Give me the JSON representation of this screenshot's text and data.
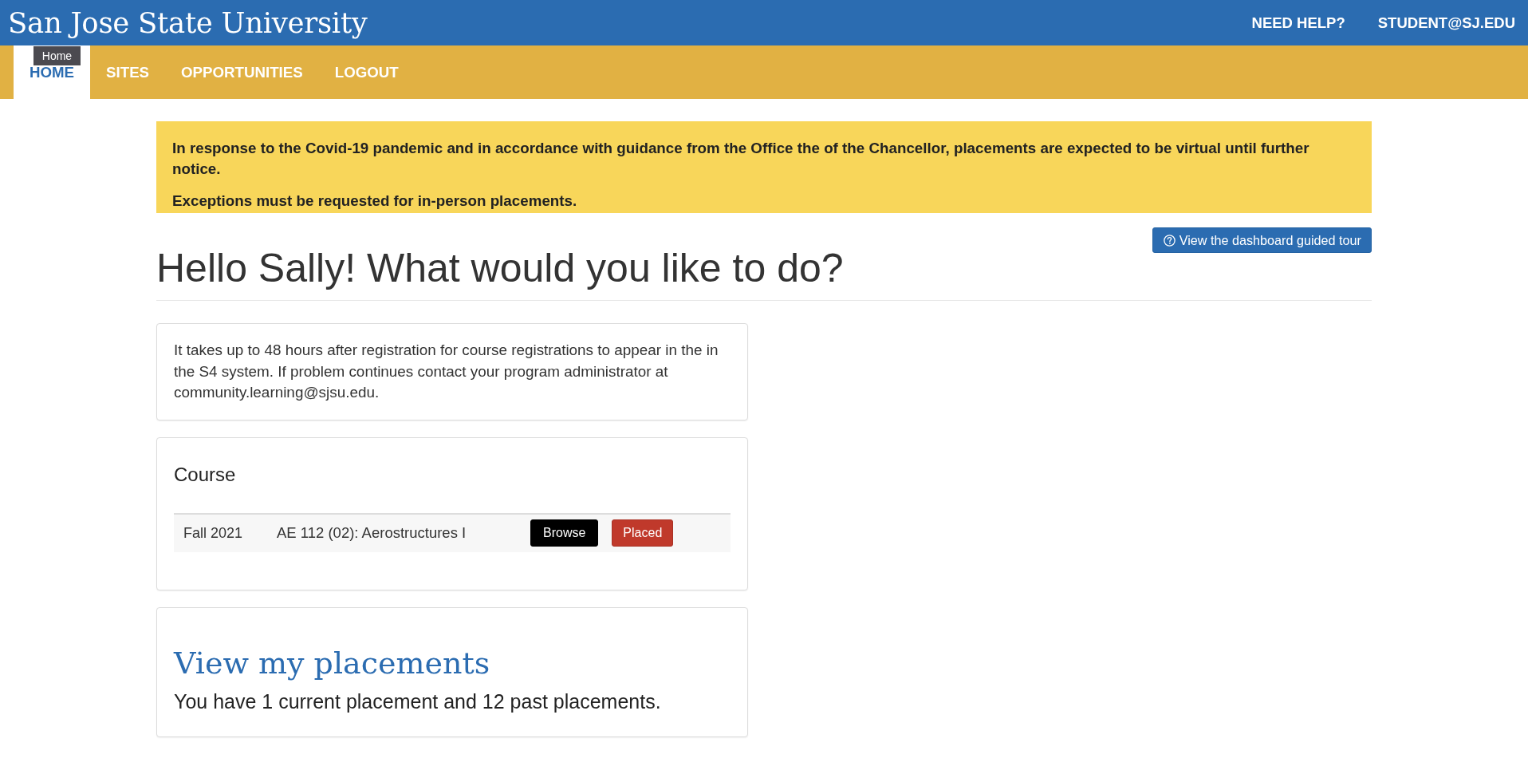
{
  "header": {
    "title": "San Jose State University",
    "links": [
      "NEED HELP?",
      "STUDENT@SJ.EDU"
    ]
  },
  "nav": {
    "tabs": [
      {
        "label": "HOME",
        "selected": true
      },
      {
        "label": "SITES",
        "selected": false
      },
      {
        "label": "OPPORTUNITIES",
        "selected": false
      },
      {
        "label": "LOGOUT",
        "selected": false
      }
    ],
    "tooltip": "Home"
  },
  "notice": {
    "paragraphs": [
      "In response to the Covid-19 pandemic and in accordance with guidance from the Office the of the Chancellor, placements are expected to be virtual until further notice.",
      "Exceptions must be requested for in-person placements."
    ]
  },
  "tour_button": {
    "label": "View the dashboard guided tour"
  },
  "heading": "Hello Sally! What would you like to do?",
  "info_card": {
    "text": "It takes up to 48 hours after registration for course registrations to appear in the in the S4 system. If problem continues contact your program administrator at community.learning@sjsu.edu."
  },
  "course_card": {
    "title": "Course",
    "rows": [
      {
        "term": "Fall 2021",
        "course": "AE 112 (02): Aerostructures I",
        "actions": [
          {
            "label": "Browse",
            "kind": "dark"
          },
          {
            "label": "Placed",
            "kind": "danger"
          }
        ]
      }
    ]
  },
  "placements_card": {
    "link": "View my placements",
    "summary": "You have 1 current placement and 12 past placements."
  }
}
